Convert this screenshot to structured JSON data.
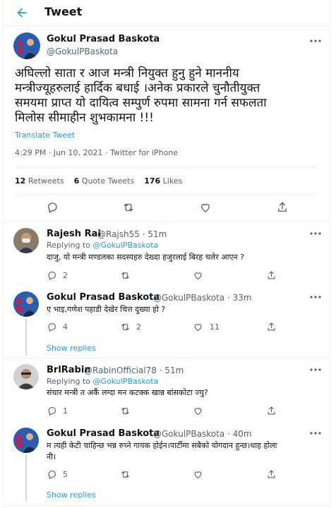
{
  "header": {
    "title": "Tweet"
  },
  "tweet": {
    "author": "Gokul Prasad Baskota",
    "handle": "@GokulPBaskota",
    "text": "अघिल्लो साता र आज मन्त्री नियुक्त हुनु हुने माननीय\nमन्त्रीज्यूहरुलाई हार्दिक बधाई ।अनेक प्रकारले चुनौतीयुक्त\nसमयमा प्राप्त यो  दायित्व सम्पुर्ण रुपमा सामना गर्न सफलता\nमिलोस सीमाहीन शुभकामना !!!",
    "translate": "Translate Tweet",
    "timestamp": "4:29 PM · Jun 10, 2021 · Twitter for iPhone",
    "retweets_count": "12",
    "retweets_label": "Retweets",
    "quotes_count": "6",
    "quotes_label": "Quote Tweets",
    "likes_count": "176",
    "likes_label": "Likes"
  },
  "replies": [
    {
      "author": "Rajesh Rai",
      "handle": "@Rajsh55 · 51m",
      "replying_prefix": "Replying to",
      "replying_to": "@GokulPBaskota",
      "text": "दाजु, यो मन्त्री मण्डलका सदस्यहरु देख्दा हजुरलाई बिरह चलेर आएन ?",
      "replies": "2",
      "retweets": "",
      "likes": ""
    },
    {
      "author": "Gokul Prasad Baskota",
      "handle": "@GokulPBaskota · 33m",
      "text": "ए भाइ,गणेश पहाडी देखेर चित्त दुख्या हो ?",
      "replies": "4",
      "retweets": "2",
      "likes": "11"
    },
    {
      "author": "BrlRabin",
      "handle": "@RabinOfficial78 · 51m",
      "replying_prefix": "Replying to",
      "replying_to": "@GokulPBaskota",
      "text": "संचार मन्त्री त अर्कै लग्दा मन कटक्क खान्न बांसकोटा ज्यु?",
      "replies": "1",
      "retweets": "",
      "likes": ""
    },
    {
      "author": "Gokul Prasad Baskota",
      "handle": "@GokulPBaskota · 40m",
      "text": "म त्यही केटी चाहिन्छ भन्न रुच्ने गायक होईन।पार्टीमा सबैको योगदान हुन्छ।थाह होला\nनी।",
      "replies": "5",
      "retweets": "",
      "likes": ""
    }
  ],
  "show_replies": "Show replies",
  "colors": {
    "accent": "#1d9bf0",
    "secondary": "#536471",
    "border": "#eff3f4"
  },
  "icons": [
    "back-arrow-icon",
    "more-icon",
    "reply-icon",
    "retweet-icon",
    "like-icon",
    "share-icon"
  ]
}
